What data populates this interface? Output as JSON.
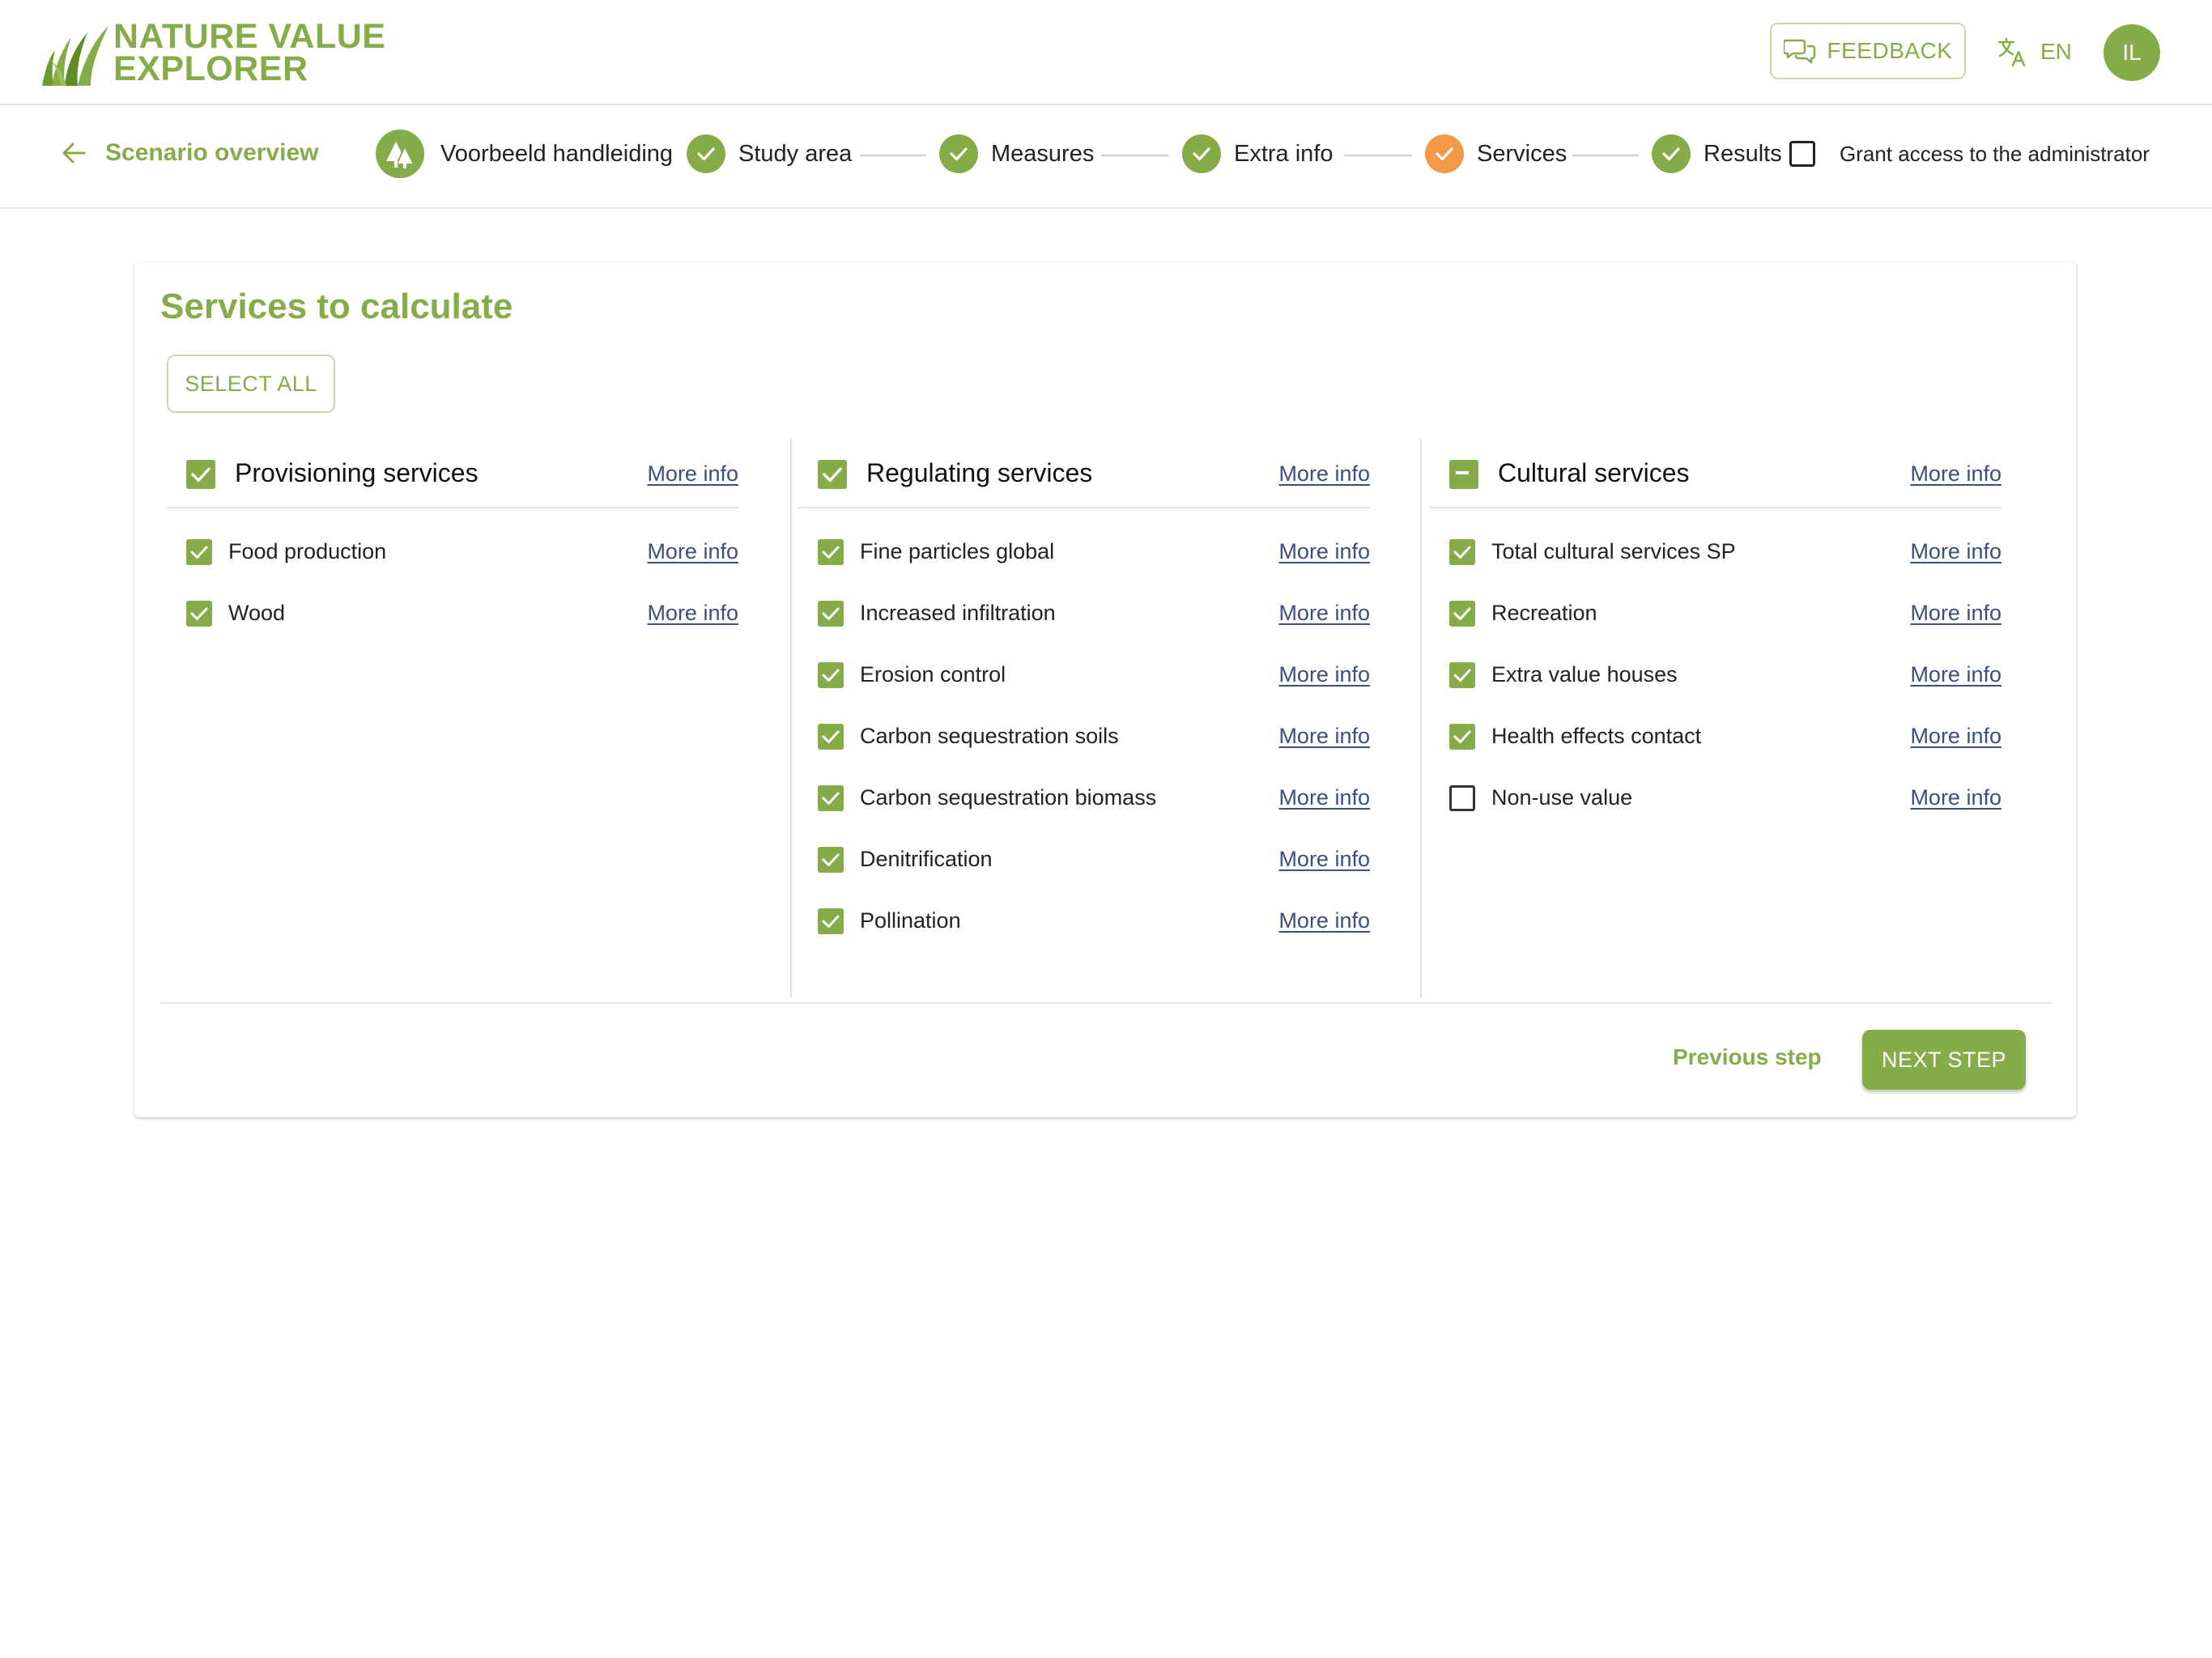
{
  "header": {
    "logo_line1": "NATURE VALUE",
    "logo_line2": "EXPLORER",
    "feedback_label": "FEEDBACK",
    "language": "EN",
    "avatar_initials": "IL",
    "icons": {
      "feedback": "chat-bubbles-icon",
      "language": "translate-icon"
    }
  },
  "stepper": {
    "back_label": "Scenario overview",
    "project_label": "Voorbeeld handleiding",
    "steps": [
      {
        "label": "Study area",
        "status": "done"
      },
      {
        "label": "Measures",
        "status": "done"
      },
      {
        "label": "Extra info",
        "status": "done"
      },
      {
        "label": "Services",
        "status": "active"
      },
      {
        "label": "Results",
        "status": "done"
      }
    ],
    "grant_access_label": "Grant access to the administrator",
    "grant_access_checked": false
  },
  "card": {
    "title": "Services to calculate",
    "select_all_label": "SELECT ALL",
    "more_info_label": "More info",
    "columns": [
      {
        "title": "Provisioning services",
        "state": "checked",
        "items": [
          {
            "label": "Food production",
            "checked": true
          },
          {
            "label": "Wood",
            "checked": true
          }
        ]
      },
      {
        "title": "Regulating services",
        "state": "checked",
        "items": [
          {
            "label": "Fine particles global",
            "checked": true
          },
          {
            "label": "Increased infiltration",
            "checked": true
          },
          {
            "label": "Erosion control",
            "checked": true
          },
          {
            "label": "Carbon sequestration soils",
            "checked": true
          },
          {
            "label": "Carbon sequestration biomass",
            "checked": true
          },
          {
            "label": "Denitrification",
            "checked": true
          },
          {
            "label": "Pollination",
            "checked": true
          }
        ]
      },
      {
        "title": "Cultural services",
        "state": "indeterminate",
        "items": [
          {
            "label": "Total cultural services SP",
            "checked": true
          },
          {
            "label": "Recreation",
            "checked": true
          },
          {
            "label": "Extra value houses",
            "checked": true
          },
          {
            "label": "Health effects contact",
            "checked": true
          },
          {
            "label": "Non-use value",
            "checked": false
          }
        ]
      }
    ],
    "previous_label": "Previous step",
    "next_label": "NEXT STEP"
  },
  "colors": {
    "accent": "#86ab49",
    "active_step": "#f29a48",
    "link": "#3c4f7c"
  }
}
